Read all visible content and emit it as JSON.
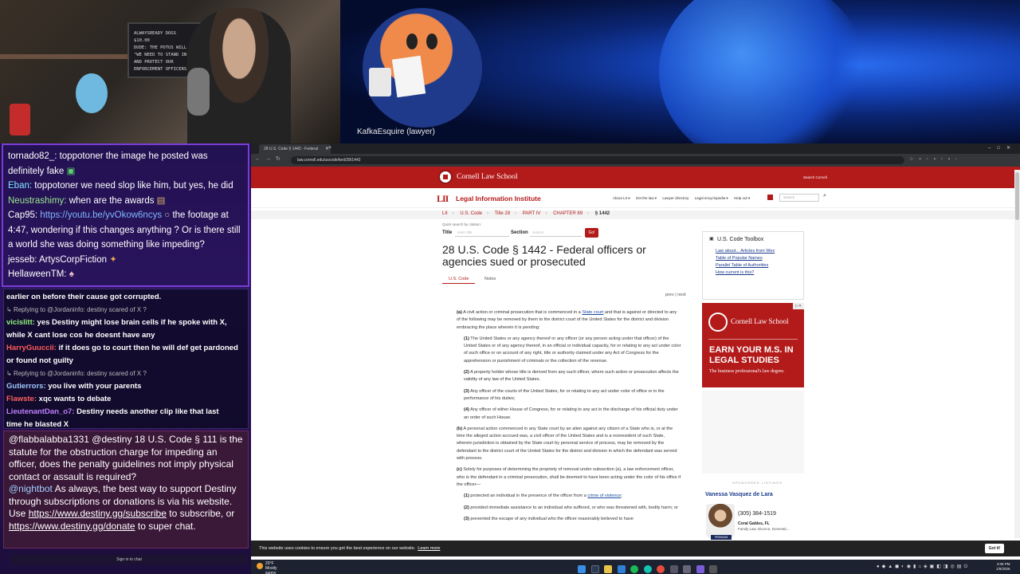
{
  "overlay": {
    "webcam_wall_text": [
      "ALWAYSREADY DOGS",
      "$10.00",
      "DUDE: THE POTUS WILL",
      "\"WE NEED TO STAND IN",
      "AND PROTECT OUR",
      "ENFORCEMENT OFFICERS\""
    ],
    "mascot_label": "KafkaEsquire (lawyer)"
  },
  "chat": {
    "top": [
      {
        "user": "tornado82_:",
        "msg": "toppotoner the image he posted was definitely fake",
        "color": "#ffffff"
      },
      {
        "user": "Eban:",
        "msg": "toppotoner we need slop like him, but yes, he did",
        "color": "#7fe8ff"
      },
      {
        "user": "Neustrashimy:",
        "msg": "when are the awards",
        "color": "#9ae68f"
      },
      {
        "user": "Cap95:",
        "msg": "https://youtu.be/yvOkow6ncys",
        "msg2": "the footage at 4:47, wondering if this changes anything ? Or is there still a world she was doing something like impeding?",
        "color": "#ffffff"
      },
      {
        "user": "jesseb:",
        "msg": "ArtysCorpFiction",
        "color": "#ffffff"
      },
      {
        "user": "HellaweenTM:",
        "msg": "",
        "color": "#ffffff"
      }
    ],
    "mid": [
      {
        "line": "earlier on before their cause got corrupted.",
        "user": "",
        "color": "#ffffff"
      },
      {
        "reply": "Replying to @Jordaninfo: destiny scared of X ?"
      },
      {
        "user": "vicislitt:",
        "line": "yes Destiny might lose brain cells if he spoke with X,",
        "color": "#8ef07a"
      },
      {
        "user": "",
        "line": "while X cant lose cos he doesnt have any",
        "color": "#ffffff"
      },
      {
        "user": "HarryGuuccii:",
        "line": "if it does go to court then he will def get pardoned",
        "color": "#ff5b5b"
      },
      {
        "user": "",
        "line": "or found not guilty",
        "color": "#ffffff"
      },
      {
        "reply": "Replying to @Jordaninfo: destiny scared of X ?"
      },
      {
        "user": "Gutierrors:",
        "line": "you live with your parents",
        "color": "#a0c8ff"
      },
      {
        "user": "Flawste:",
        "line": "xqc wants to debate",
        "color": "#ff6060"
      },
      {
        "user": "LieutenantDan_o7:",
        "line": "Destiny needs another clip like that last",
        "color": "#c080ff"
      },
      {
        "user": "",
        "line": "time he blasted X",
        "color": "#ffffff"
      }
    ],
    "bot": {
      "msg1_user": "@flabbalabba1331",
      "msg1": "@destiny 18 U.S. Code § 111 is the statute for the obstruction charge for impeding an officer, does the penalty guidelines not imply physical contact or assault is required?",
      "msg2_user": "@nightbot",
      "msg2_a": "As always, the best way to support Destiny through subscriptions or donations is via his website. Use",
      "link1": "https://www.destiny.gg/subscribe",
      "msg2_b": "to subscribe, or",
      "link2": "https://www.destiny.gg/donate",
      "msg2_c": "to super chat."
    },
    "signin": "Sign in to chat"
  },
  "browser": {
    "tab_title": "28 U.S. Code § 1442 - Federal",
    "url": "law.cornell.edu/uscode/text/28/1442",
    "header": {
      "brand": "Cornell Law School",
      "search_cornell": "Search Cornell"
    },
    "lii": {
      "mark": "LII",
      "name": "Legal Information Institute"
    },
    "topnav": [
      "About LII ▾",
      "Get the law ▾",
      "Lawyer directory",
      "Legal encyclopedia ▾",
      "Help out ▾"
    ],
    "search_placeholder": "Search",
    "breadcrumbs": [
      "LII",
      "U.S. Code",
      "Title 28",
      "PART IV",
      "CHAPTER 89",
      "§ 1442"
    ],
    "quick_search": {
      "label": "Quick search by citation:",
      "title_label": "Title",
      "title_placeholder": "enter title",
      "section_label": "Section",
      "section_placeholder": "section",
      "go": "Go!"
    },
    "doc_title": "28 U.S. Code § 1442 - Federal officers or agencies sued or prosecuted",
    "tabs": [
      "U.S. Code",
      "Notes"
    ],
    "prev": "prev",
    "next": "next",
    "doc": {
      "a_label": "(a)",
      "a_text_1": "A civil action or criminal prosecution that is commenced in a",
      "a_link": "State court",
      "a_text_2": "and that is against or directed to any of the following may be removed by them to the district court of the United States for the district and division embracing the place wherein it is pending:",
      "a1_label": "(1)",
      "a1": "The United States or any agency thereof or any officer (or any person acting under that officer) of the United States or of any agency thereof, in an official or individual capacity, for or relating to any act under color of such office or on account of any right, title or authority claimed under any Act of Congress for the apprehension or punishment of criminals or the collection of the revenue.",
      "a2_label": "(2)",
      "a2": "A property holder whose title is derived from any such officer, where such action or prosecution affects the validity of any law of the United States.",
      "a3_label": "(3)",
      "a3": "Any officer of the courts of the United States, for or relating to any act under color of office or in the performance of his duties;",
      "a4_label": "(4)",
      "a4": "Any officer of either House of Congress, for or relating to any act in the discharge of his official duty under an order of such House.",
      "b_label": "(b)",
      "b": "A personal action commenced in any State court by an alien against any citizen of a State who is, or at the time the alleged action accrued was, a civil officer of the United States and is a nonresident of such State, wherein jurisdiction is obtained by the State court by personal service of process, may be removed by the defendant to the district court of the United States for the district and division in which the defendant was served with process.",
      "c_label": "(c)",
      "c": "Solely for purposes of determining the propriety of removal under subsection (a), a law enforcement officer, who is the defendant in a criminal prosecution, shall be deemed to have been acting under the color of his office if the officer—",
      "c1_label": "(1)",
      "c1_text": "protected an individual in the presence of the officer from a",
      "c1_link": "crime of violence",
      "c1_end": ";",
      "c2_label": "(2)",
      "c2": "provided immediate assistance to an individual who suffered, or who was threatened with, bodily harm; or",
      "c3_label": "(3)",
      "c3": "prevented the escape of any individual who the officer reasonably believed to have"
    },
    "toolbox": {
      "title": "U.S. Code Toolbox",
      "links": [
        "Law about... Articles from Wex",
        "Table of Popular Names",
        "Parallel Table of Authorities",
        "How current is this?"
      ]
    },
    "ad": {
      "brand": "Cornell Law School",
      "headline": "EARN YOUR M.S. IN LEGAL STUDIES",
      "sub": "The business professional's law degree."
    },
    "sponsored": {
      "label": "SPONSORED LISTINGS",
      "name": "Vanessa Vasquez de Lara",
      "phone": "(305) 384-1519",
      "location": "Coral Gables, FL",
      "areas": "Family Law, Divorce, Domestic...",
      "badge": "PREMIUM"
    },
    "cookie": {
      "text": "This website uses cookies to ensure you get the best experience on our website.",
      "learn": "Learn more",
      "ok": "Got it!"
    }
  },
  "taskbar": {
    "weather_temp": "29°F",
    "weather_desc": "Mostly sunny",
    "time": "4:05 PM",
    "date": "1/9/2026"
  }
}
